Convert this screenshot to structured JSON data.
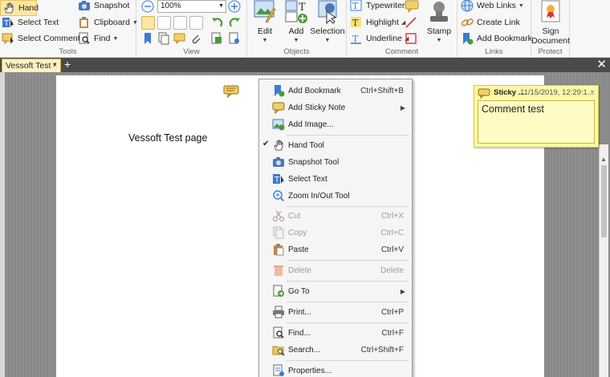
{
  "tools": {
    "label": "Tools",
    "hand": "Hand",
    "select_text": "Select Text",
    "select_comments": "Select Comments",
    "snapshot": "Snapshot",
    "clipboard": "Clipboard",
    "find": "Find"
  },
  "view": {
    "label": "View",
    "zoom": "100%"
  },
  "objects": {
    "label": "Objects",
    "edit": "Edit",
    "add": "Add",
    "selection": "Selection"
  },
  "comment": {
    "label": "Comment",
    "typewriter": "Typewriter",
    "highlight": "Highlight",
    "underline": "Underline",
    "stamp": "Stamp"
  },
  "links": {
    "label": "Links",
    "web_links": "Web Links",
    "create_link": "Create Link",
    "add_bookmark": "Add Bookmark"
  },
  "protect": {
    "label": "Protect",
    "sign_line1": "Sign",
    "sign_line2": "Document"
  },
  "tab": {
    "title": "Vessoft Test *",
    "close": "×",
    "add": "+"
  },
  "window": {
    "close": "✕"
  },
  "document": {
    "text": "Vessoft Test page"
  },
  "sticky": {
    "title": "Sticky ...",
    "date": "11/15/2019, 12:29:1...",
    "close": "×",
    "content": "Comment test"
  },
  "context_menu": {
    "add_bookmark": {
      "label": "Add Bookmark",
      "key": "Ctrl+Shift+B"
    },
    "add_sticky_note": {
      "label": "Add Sticky Note"
    },
    "add_image": {
      "label": "Add Image..."
    },
    "hand_tool": {
      "label": "Hand Tool",
      "check": "✔"
    },
    "snapshot_tool": {
      "label": "Snapshot Tool"
    },
    "select_text": {
      "label": "Select Text"
    },
    "zoom_tool": {
      "label": "Zoom In/Out Tool"
    },
    "cut": {
      "label": "Cut",
      "key": "Ctrl+X"
    },
    "copy": {
      "label": "Copy",
      "key": "Ctrl+C"
    },
    "paste": {
      "label": "Paste",
      "key": "Ctrl+V"
    },
    "delete": {
      "label": "Delete",
      "key": "Delete"
    },
    "go_to": {
      "label": "Go To"
    },
    "print": {
      "label": "Print...",
      "key": "Ctrl+P"
    },
    "find": {
      "label": "Find...",
      "key": "Ctrl+F"
    },
    "search": {
      "label": "Search...",
      "key": "Ctrl+Shift+F"
    },
    "properties": {
      "label": "Properties..."
    }
  },
  "colors": {
    "accent": "#f3cf6b",
    "sticky": "#fdf8a6",
    "menu_icon_blue": "#3a7bd5"
  }
}
